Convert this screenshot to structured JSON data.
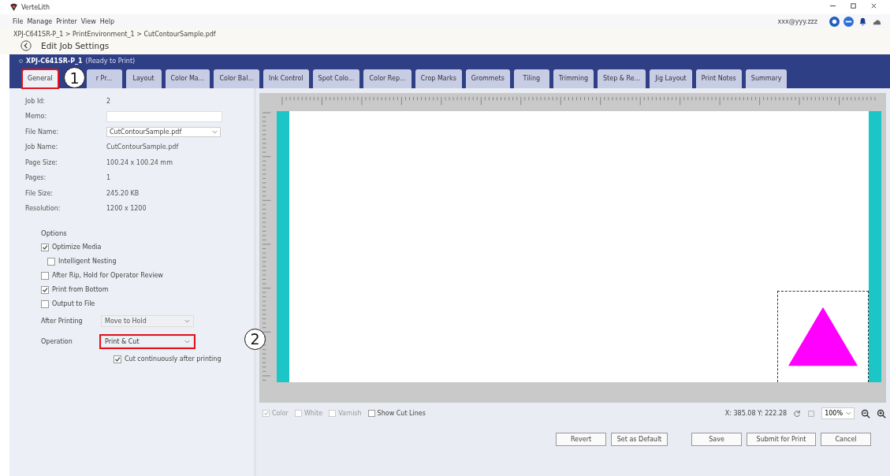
{
  "app": {
    "title": "VerteLith"
  },
  "menu": [
    "File",
    "Manage",
    "Printer",
    "View",
    "Help"
  ],
  "user": {
    "email": "xxx@yyy.zzz"
  },
  "breadcrumb": "XPJ-C641SR-P_1 > PrintEnvironment_1 > CutContourSample.pdf",
  "page_title": "Edit Job Settings",
  "printer": {
    "name": "XPJ-C641SR-P_1",
    "status": "(Ready to Print)"
  },
  "tabs": [
    {
      "label": "General",
      "selected": true,
      "highlighted": true,
      "callout": "1"
    },
    {
      "label": "r Pr...",
      "selected": false,
      "highlighted": false
    },
    {
      "label": "Layout",
      "selected": false,
      "highlighted": false
    },
    {
      "label": "Color Ma...",
      "selected": false,
      "highlighted": false
    },
    {
      "label": "Color Bal...",
      "selected": false,
      "highlighted": false
    },
    {
      "label": "Ink Control",
      "selected": false,
      "highlighted": false
    },
    {
      "label": "Spot Colo...",
      "selected": false,
      "highlighted": false
    },
    {
      "label": "Color Rep...",
      "selected": false,
      "highlighted": false
    },
    {
      "label": "Crop Marks",
      "selected": false,
      "highlighted": false
    },
    {
      "label": "Grommets",
      "selected": false,
      "highlighted": false
    },
    {
      "label": "Tiling",
      "selected": false,
      "highlighted": false
    },
    {
      "label": "Trimming",
      "selected": false,
      "highlighted": false
    },
    {
      "label": "Step & Re...",
      "selected": false,
      "highlighted": false
    },
    {
      "label": "Jig Layout",
      "selected": false,
      "highlighted": false
    },
    {
      "label": "Print Notes",
      "selected": false,
      "highlighted": false
    },
    {
      "label": "Summary",
      "selected": false,
      "highlighted": false
    }
  ],
  "job_info": [
    {
      "label": "Job Id:",
      "kind": "text",
      "value": "2"
    },
    {
      "label": "Memo:",
      "kind": "input"
    },
    {
      "label": "File Name:",
      "kind": "select",
      "value": "CutContourSample.pdf"
    },
    {
      "label": "Job Name:",
      "kind": "text",
      "value": "CutContourSample.pdf"
    },
    {
      "label": "Page Size:",
      "kind": "text",
      "value": "100.24 x 100.24 mm"
    },
    {
      "label": "Pages:",
      "kind": "text",
      "value": "1"
    },
    {
      "label": "File Size:",
      "kind": "text",
      "value": "245.20 KB"
    },
    {
      "label": "Resolution:",
      "kind": "text",
      "value": "1200 x 1200"
    }
  ],
  "options": {
    "title": "Options",
    "checkboxes": [
      {
        "label": "Optimize Media",
        "checked": true,
        "children": [
          {
            "label": "Intelligent Nesting",
            "checked": false
          }
        ]
      },
      {
        "label": "After Rip, Hold for Operator Review",
        "checked": false
      },
      {
        "label": "Print from Bottom",
        "checked": true
      },
      {
        "label": "Output to File",
        "checked": false
      }
    ]
  },
  "after_printing": {
    "label": "After Printing",
    "value": "Move to Hold",
    "highlighted": false
  },
  "operation": {
    "label": "Operation",
    "value": "Print & Cut",
    "highlighted": true,
    "callout": "2"
  },
  "cut_continuously": {
    "label": "Cut continuously after printing",
    "checked": true
  },
  "preview_toggles": [
    {
      "label": "Color",
      "checked": true,
      "disabled": true
    },
    {
      "label": "White",
      "checked": false,
      "disabled": true
    },
    {
      "label": "Varnish",
      "checked": false,
      "disabled": true
    },
    {
      "label": "Show Cut Lines",
      "checked": false,
      "disabled": false
    }
  ],
  "coordinates": "X: 385.08 Y: 222.28",
  "zoom": "100%",
  "buttons": [
    "Revert",
    "Set as Default",
    "Save",
    "Submit for Print",
    "Cancel"
  ]
}
